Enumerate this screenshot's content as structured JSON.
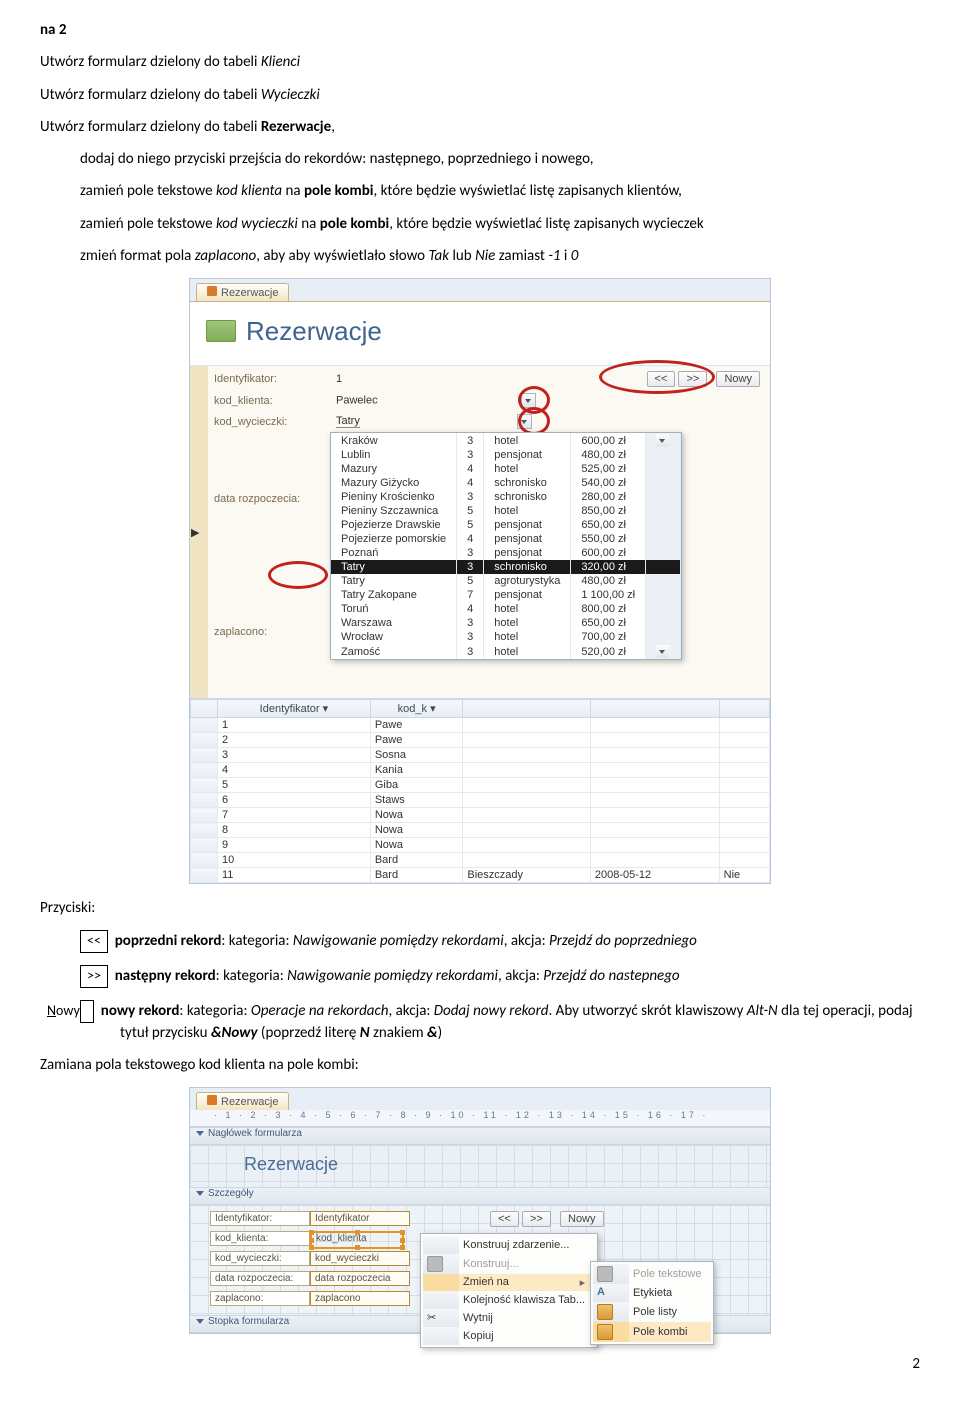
{
  "doc": {
    "heading": "na 2",
    "p1a": "Utwórz formularz dzielony do tabeli ",
    "p1b": "Klienci",
    "p2a": "Utwórz formularz dzielony do tabeli ",
    "p2b": "Wycieczki",
    "p3a": "Utwórz formularz dzielony do tabeli ",
    "p3b": "Rezerwacje",
    "p3c": ",",
    "p4a": "dodaj do niego przyciski przejścia do rekordów: następnego, poprzedniego i nowego,",
    "p5a": "zamień pole tekstowe ",
    "p5b": "kod klienta",
    "p5c": " na ",
    "p5d": "pole kombi",
    "p5e": ", które będzie wyświetlać listę zapisanych klientów,",
    "p6a": "zamień pole tekstowe ",
    "p6b": "kod wycieczki",
    "p6c": " na ",
    "p6d": "pole kombi",
    "p6e": ", które będzie wyświetlać listę zapisanych wycieczek",
    "p7a": "zmień format pola ",
    "p7b": "zaplacono",
    "p7c": ", aby aby wyświetlało słowo ",
    "p7d": "Tak",
    "p7e": " lub ",
    "p7f": "Nie",
    "p7g": " zamiast ",
    "p7h": "-1",
    "p7i": " i ",
    "p7j": "0",
    "przyciski_label": "Przyciski:",
    "btn_prev_sym": "<<",
    "btn_prev_a": "poprzedni rekord",
    "btn_prev_b": ": kategoria: ",
    "btn_prev_c": "Nawigowanie pomiędzy rekordami",
    "btn_prev_d": ", akcja: ",
    "btn_prev_e": "Przejdź do poprzedniego",
    "btn_next_sym": ">>",
    "btn_next_a": "następny rekord",
    "btn_next_c": "Nawigowanie pomiędzy rekordami",
    "btn_next_e": "Przejdź do nastepnego",
    "btn_new_under": "N",
    "btn_new_rest": "owy",
    "btn_new_a": "nowy rekord",
    "btn_new_b": ": kategoria: ",
    "btn_new_c": "Operacje na rekordach",
    "btn_new_d": ", akcja: ",
    "btn_new_e": "Dodaj nowy rekord",
    "btn_new_f": ". Aby utworzyć skrót klawiszowy ",
    "btn_new_g": "Alt-N",
    "btn_new_h": " dla tej operacji, podaj tytuł przycisku ",
    "btn_new_i": "&Nowy",
    "btn_new_j": " (poprzedź literę ",
    "btn_new_k": "N",
    "btn_new_l": " znakiem ",
    "btn_new_m": "&",
    "btn_new_n": ")",
    "zamiana": "Zamiana pola tekstowego kod klienta na pole kombi:",
    "page": "2"
  },
  "shot1": {
    "tab": "Rezerwacje",
    "title": "Rezerwacje",
    "lbl_id": "Identyfikator:",
    "val_id": "1",
    "lbl_kk": "kod_klienta:",
    "val_kk": "Pawelec",
    "lbl_kw": "kod_wycieczki:",
    "val_kw": "Tatry",
    "lbl_dr": "data rozpoczecia:",
    "lbl_zp": "zaplacono:",
    "btn_prev": "<<",
    "btn_next": ">>",
    "btn_new": "Nowy",
    "dd": [
      [
        "Kraków",
        "3",
        "hotel",
        "600,00 zł"
      ],
      [
        "Lublin",
        "3",
        "pensjonat",
        "480,00 zł"
      ],
      [
        "Mazury",
        "4",
        "hotel",
        "525,00 zł"
      ],
      [
        "Mazury Giżycko",
        "4",
        "schronisko",
        "540,00 zł"
      ],
      [
        "Pieniny Krościenko",
        "3",
        "schronisko",
        "280,00 zł"
      ],
      [
        "Pieniny Szczawnica",
        "5",
        "hotel",
        "850,00 zł"
      ],
      [
        "Pojezierze Drawskie",
        "5",
        "pensjonat",
        "650,00 zł"
      ],
      [
        "Pojezierze pomorskie",
        "4",
        "pensjonat",
        "550,00 zł"
      ],
      [
        "Poznań",
        "3",
        "pensjonat",
        "600,00 zł"
      ],
      [
        "Tatry",
        "3",
        "schronisko",
        "320,00 zł"
      ],
      [
        "Tatry",
        "5",
        "agroturystyka",
        "480,00 zł"
      ],
      [
        "Tatry Zakopane",
        "7",
        "pensjonat",
        "1 100,00 zł"
      ],
      [
        "Toruń",
        "4",
        "hotel",
        "800,00 zł"
      ],
      [
        "Warszawa",
        "3",
        "hotel",
        "650,00 zł"
      ],
      [
        "Wrocław",
        "3",
        "hotel",
        "700,00 zł"
      ],
      [
        "Zamość",
        "3",
        "hotel",
        "520,00 zł"
      ]
    ],
    "dd_sel": 9,
    "grid_hdr": [
      "Identyfikator",
      "kod_k"
    ],
    "grid_rows": [
      [
        "1",
        "Pawe"
      ],
      [
        "2",
        "Pawe"
      ],
      [
        "3",
        "Sosna"
      ],
      [
        "4",
        "Kania"
      ],
      [
        "5",
        "Giba"
      ],
      [
        "6",
        "Staws"
      ],
      [
        "7",
        "Nowa"
      ],
      [
        "8",
        "Nowa"
      ],
      [
        "9",
        "Nowa"
      ],
      [
        "10",
        "Bard"
      ],
      [
        "11",
        "Bard"
      ]
    ],
    "grid_tail": [
      "Bieszczady",
      "2008-05-12",
      "Nie"
    ]
  },
  "shot2": {
    "tab": "Rezerwacje",
    "band_hdr": "Nagłówek formularza",
    "title": "Rezerwacje",
    "band_detail": "Szczegóły",
    "labels": [
      "Identyfikator:",
      "kod_klienta:",
      "kod_wycieczki:",
      "data rozpoczecia:",
      "zaplacono:"
    ],
    "fields": [
      "Identyfikator",
      "kod_klienta",
      "kod_wycieczki",
      "data rozpoczecia",
      "zaplacono"
    ],
    "btn_prev": "<<",
    "btn_next": ">>",
    "btn_new": "Nowy",
    "band_footer": "Stopka formularza",
    "ctx": {
      "build_event": "Konstruuj zdarzenie...",
      "build": "Konstruuj...",
      "change_to": "Zmień na",
      "tab_order": "Kolejność klawisza Tab...",
      "cut": "Wytnij",
      "copy": "Kopiuj"
    },
    "sub": {
      "textbox": "Pole tekstowe",
      "label": "Etykieta",
      "listbox": "Pole listy",
      "combobox": "Pole kombi"
    }
  }
}
